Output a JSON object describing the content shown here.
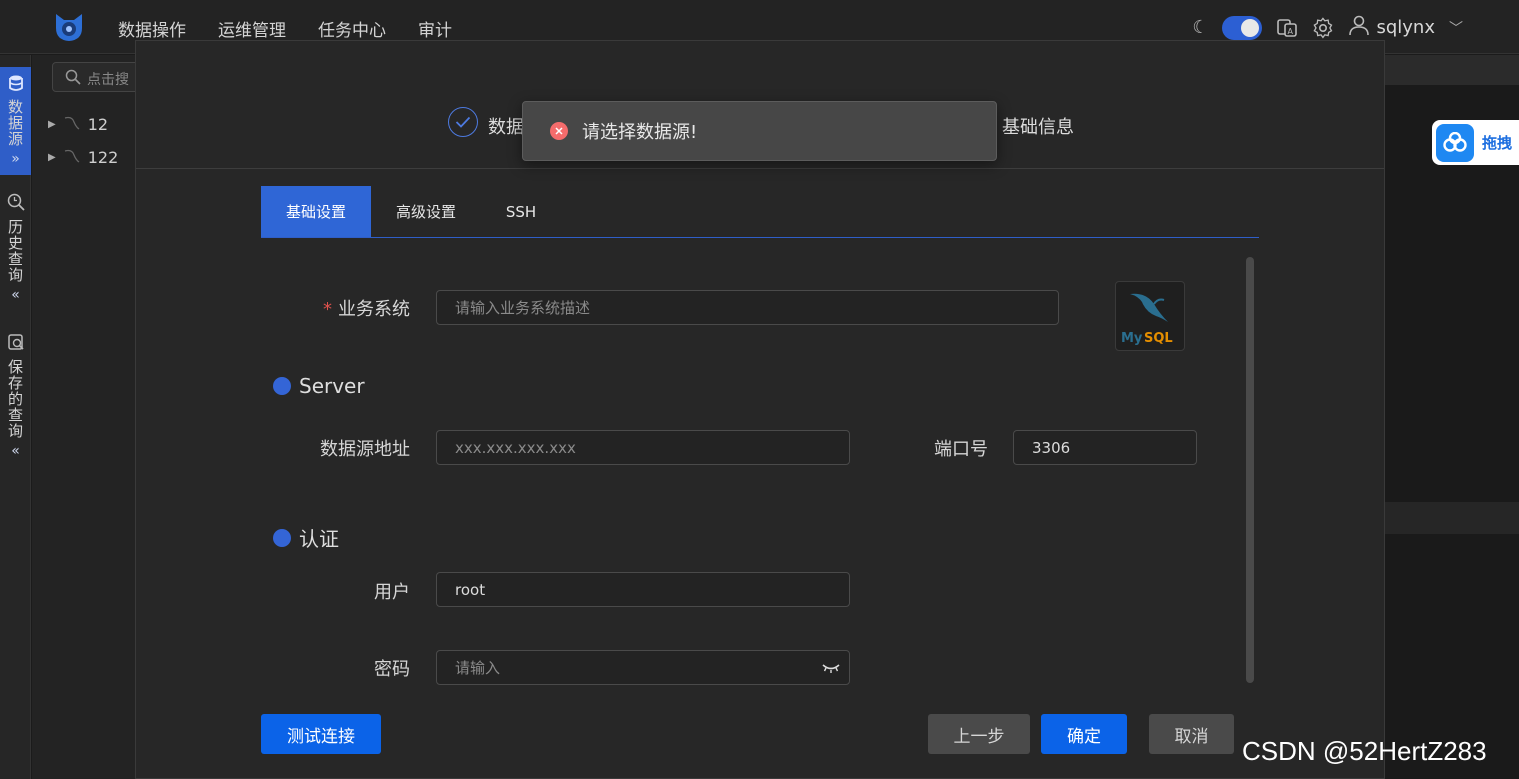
{
  "nav": {
    "items": [
      "数据操作",
      "运维管理",
      "任务中心",
      "审计"
    ],
    "username": "sqlynx"
  },
  "sidebar": {
    "groups": [
      {
        "label": "数据源",
        "icon": "database-icon",
        "active": true
      },
      {
        "label": "历史查询",
        "icon": "history-search-icon",
        "active": false
      },
      {
        "label": "保存的查询",
        "icon": "saved-query-icon",
        "active": false
      }
    ]
  },
  "tree": {
    "search_placeholder": "点击搜",
    "items": [
      {
        "label": "12"
      },
      {
        "label": "122"
      }
    ]
  },
  "drag_widget": {
    "label": "拖拽"
  },
  "modal": {
    "steps": {
      "step1": "数据",
      "step3": "基础信息"
    },
    "tabs": [
      "基础设置",
      "高级设置",
      "SSH"
    ],
    "business_system": {
      "label": "业务系统",
      "placeholder": "请输入业务系统描述"
    },
    "server_section": "Server",
    "host": {
      "label": "数据源地址",
      "placeholder": "xxx.xxx.xxx.xxx"
    },
    "port": {
      "label": "端口号",
      "value": "3306"
    },
    "auth_section": "认证",
    "user": {
      "label": "用户",
      "value": "root"
    },
    "password": {
      "label": "密码",
      "placeholder": "请输入"
    },
    "buttons": {
      "test": "测试连接",
      "prev": "上一步",
      "confirm": "确定",
      "cancel": "取消"
    }
  },
  "toast": {
    "message": "请选择数据源!"
  },
  "watermark": "CSDN @52HertZ283",
  "colors": {
    "accent": "#2f66d6",
    "primary_button": "#0b63e8",
    "error": "#f56c6c"
  }
}
